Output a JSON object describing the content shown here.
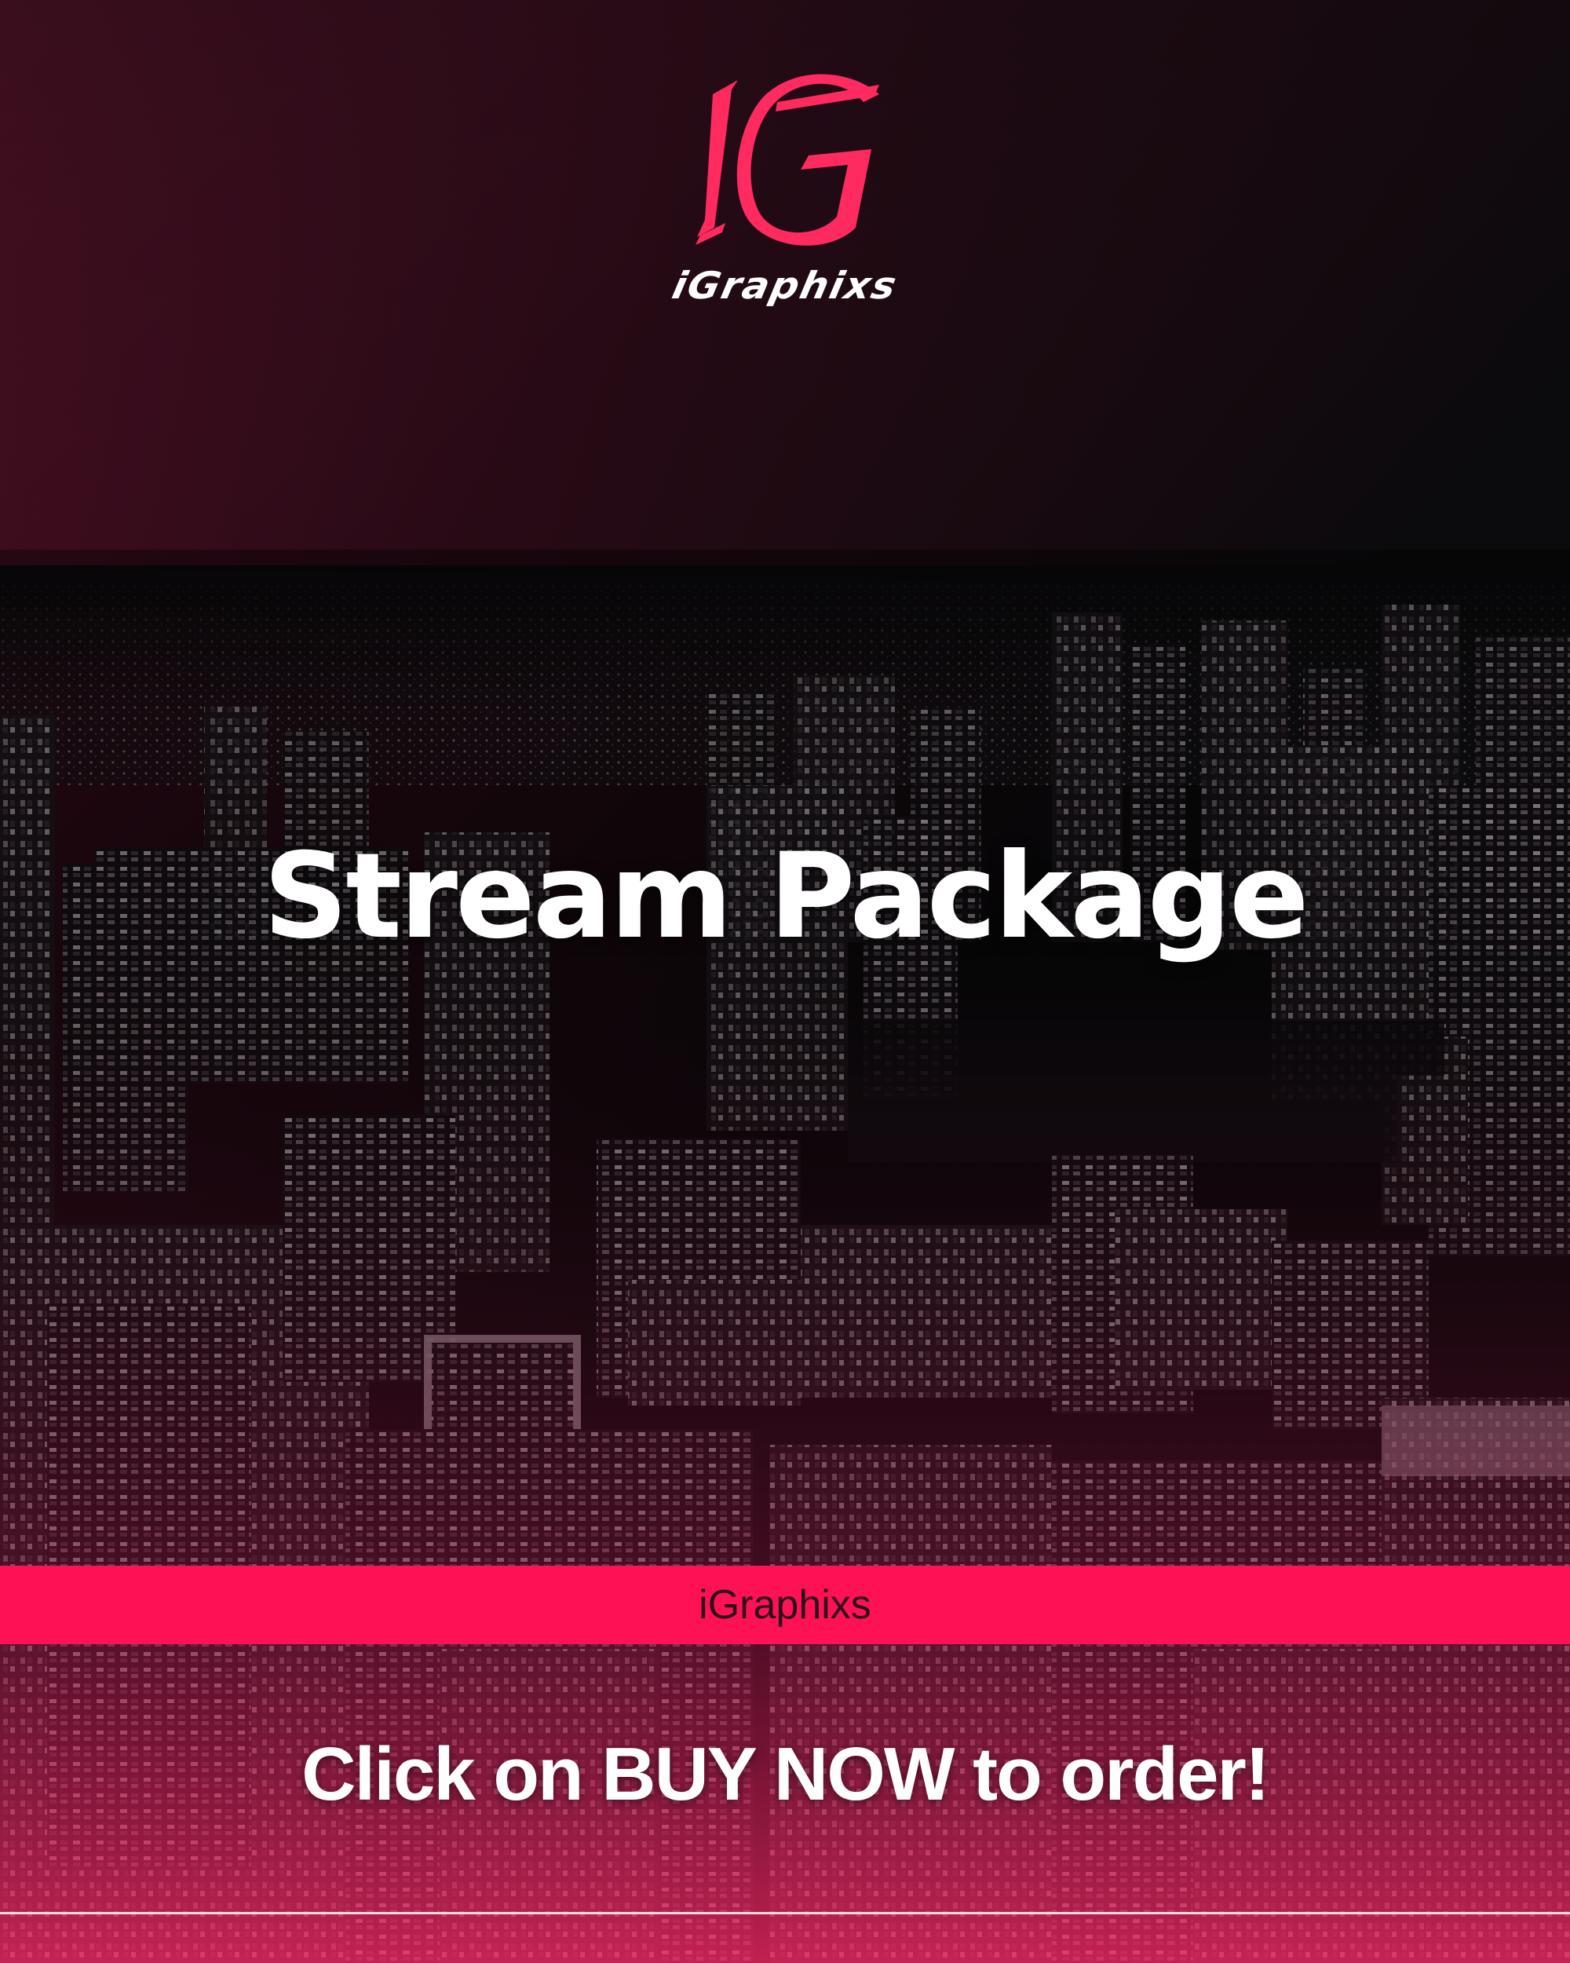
{
  "brand": {
    "logo_mark": "IG",
    "logo_wordmark": "iGraphixs",
    "band_text": "iGraphixs",
    "accent_color": "#ff1155"
  },
  "headline": "Stream Package",
  "cta": "Click on BUY NOW to order!",
  "background": {
    "icon": "night-city-skyline-image",
    "tint_color": "#c2185b"
  }
}
